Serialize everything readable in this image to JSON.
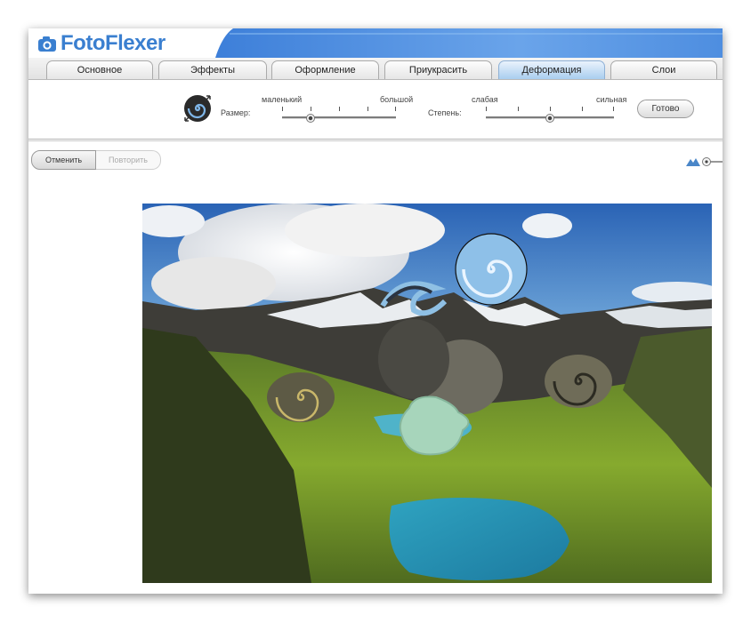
{
  "app": {
    "name": "FotoFlexer"
  },
  "tabs": [
    {
      "label": "Основное",
      "active": false
    },
    {
      "label": "Эффекты",
      "active": false
    },
    {
      "label": "Оформление",
      "active": false
    },
    {
      "label": "Приукрасить",
      "active": false
    },
    {
      "label": "Деформация",
      "active": true
    },
    {
      "label": "Слои",
      "active": false
    }
  ],
  "toolbar": {
    "tool_icon": "swirl-tool-icon",
    "size": {
      "label": "Размер:",
      "min_label": "маленький",
      "max_label": "большой",
      "value_fraction": 0.25
    },
    "strength": {
      "label": "Степень:",
      "min_label": "слабая",
      "max_label": "сильная",
      "value_fraction": 0.5
    },
    "done_label": "Готово"
  },
  "history": {
    "undo_label": "Отменить",
    "redo_label": "Повторить",
    "redo_enabled": false
  },
  "zoom": {
    "icon": "mountain-zoom-icon"
  },
  "colors": {
    "brand_blue": "#3a7fd0",
    "active_tab": "#a9cdef"
  }
}
